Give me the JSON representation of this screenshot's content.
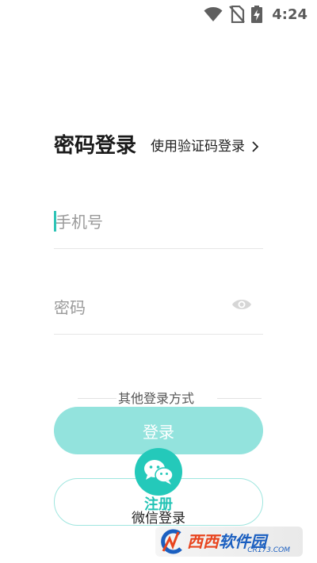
{
  "status_bar": {
    "time": "4:24",
    "icons": [
      "wifi-icon",
      "no-sim-icon",
      "battery-charging-icon"
    ]
  },
  "login": {
    "title": "密码登录",
    "switch_link": "使用验证码登录"
  },
  "form": {
    "phone_placeholder": "手机号",
    "password_placeholder": "密码"
  },
  "divider_text": "其他登录方式",
  "login_button": "登录",
  "register_button": "注册",
  "wechat_label": "微信登录",
  "watermark": {
    "text_red": "西西",
    "text_blue": "软件园",
    "url": "CR173.COM"
  },
  "colors": {
    "accent": "#24c9ba",
    "login_button_bg": "#93e3dd",
    "register_border": "#9fe6df",
    "caret": "#2ec4b6"
  }
}
